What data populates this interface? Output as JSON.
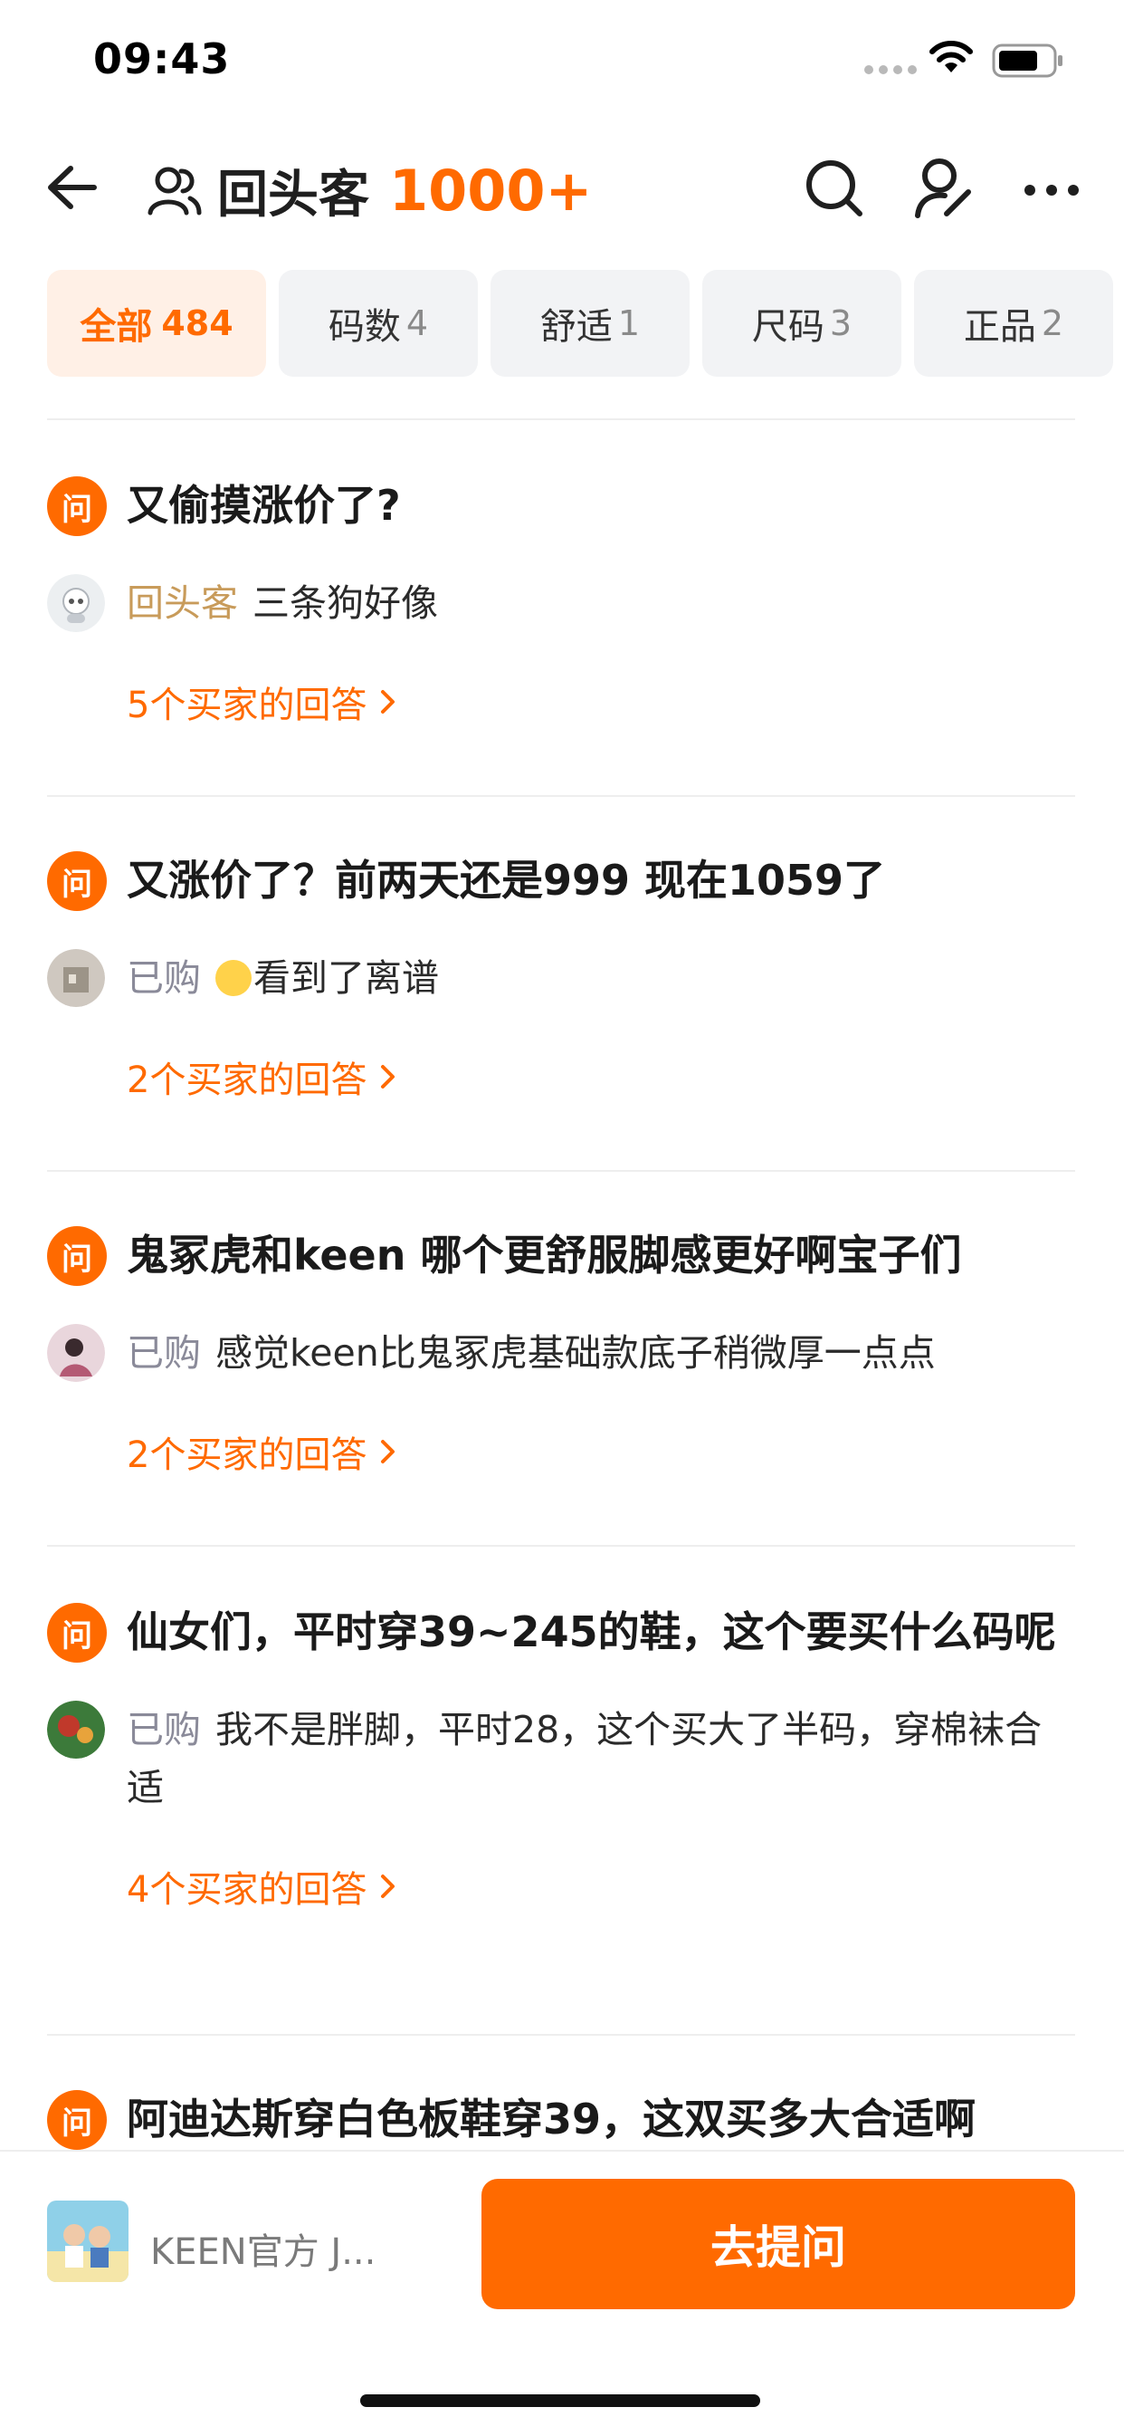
{
  "status_bar": {
    "time": "09:43"
  },
  "header": {
    "title": "回头客",
    "count": "1000+",
    "icons": [
      "back-arrow-icon",
      "user-icon",
      "search-icon",
      "user-edit-icon",
      "more-icon"
    ]
  },
  "tabs": [
    {
      "label": "全部",
      "count": "484",
      "active": true
    },
    {
      "label": "码数",
      "count": "4",
      "active": false
    },
    {
      "label": "舒适",
      "count": "1",
      "active": false
    },
    {
      "label": "尺码",
      "count": "3",
      "active": false
    },
    {
      "label": "正品",
      "count": "2",
      "active": false
    }
  ],
  "questions": [
    {
      "badge": "问",
      "question": "又偷摸涨价了?",
      "answer_tag": "回头客",
      "answer": "三条狗好像",
      "more": "5个买家的回答"
    },
    {
      "badge": "问",
      "question": "又涨价了？前两天还是999 现在1059了",
      "answer_tag": "已购",
      "answer": "看到了离谱",
      "more": "2个买家的回答"
    },
    {
      "badge": "问",
      "question": "鬼冢虎和keen 哪个更舒服脚感更好啊宝子们",
      "answer_tag": "已购",
      "answer": "感觉keen比鬼冢虎基础款底子稍微厚一点点",
      "more": "2个买家的回答"
    },
    {
      "badge": "问",
      "question": "仙女们，平时穿39~245的鞋，这个要买什么码呢",
      "answer_tag": "已购",
      "answer": "我不是胖脚，平时28，这个买大了半码，穿棉袜合适",
      "more": "4个买家的回答"
    },
    {
      "badge": "问",
      "question": "阿迪达斯穿白色板鞋穿39，这双买多大合适啊"
    }
  ],
  "bottom_bar": {
    "shop_name": "KEEN官方 J...",
    "ask_button": "去提问"
  },
  "colors": {
    "accent": "#ff6a00",
    "tab_active_bg": "#fff0e6",
    "tab_bg": "#f2f3f5",
    "tag_gold": "#c89b5a",
    "tag_gray": "#8a8a99"
  }
}
